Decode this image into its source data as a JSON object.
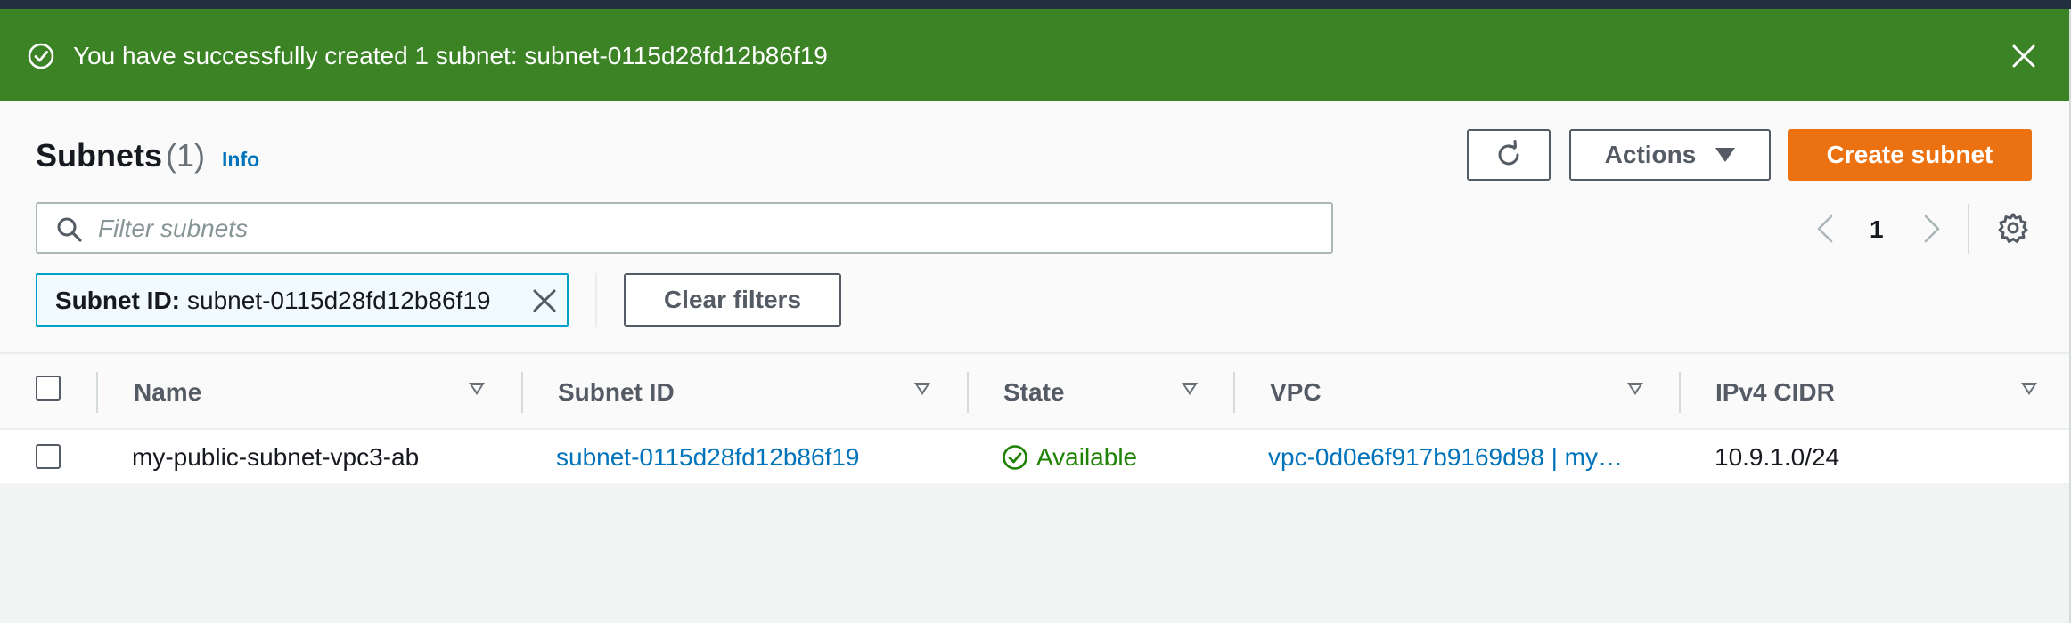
{
  "flash": {
    "message": "You have successfully created 1 subnet: subnet-0115d28fd12b86f19",
    "icon": "check-circle-icon",
    "close_icon": "close-icon",
    "color": "#3b8324"
  },
  "header": {
    "title": "Subnets",
    "count": "(1)",
    "info": "Info"
  },
  "toolbar": {
    "refresh_icon": "refresh-icon",
    "actions_label": "Actions",
    "create_label": "Create subnet",
    "create_color": "#ec7211"
  },
  "search": {
    "placeholder": "Filter subnets",
    "value": ""
  },
  "pagination": {
    "current_page": "1"
  },
  "filter_token": {
    "label": "Subnet ID:",
    "value": "subnet-0115d28fd12b86f19"
  },
  "clear_filters_label": "Clear filters",
  "table": {
    "columns": [
      "Name",
      "Subnet ID",
      "State",
      "VPC",
      "IPv4 CIDR"
    ],
    "rows": [
      {
        "selected": false,
        "name": "my-public-subnet-vpc3-ab",
        "subnet_id": "subnet-0115d28fd12b86f19",
        "state": "Available",
        "vpc": "vpc-0d0e6f917b9169d98 | my…",
        "ipv4_cidr": "10.9.1.0/24"
      }
    ]
  }
}
